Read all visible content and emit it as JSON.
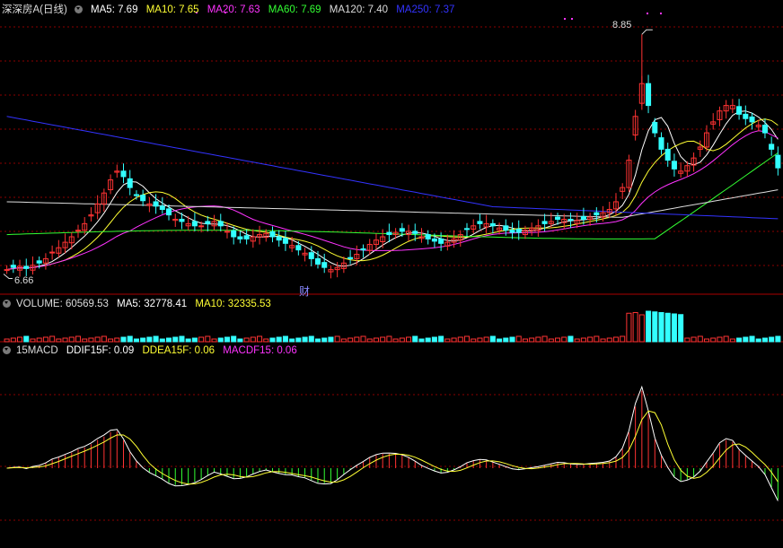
{
  "header": {
    "stock_name": "深深房A",
    "period": "(日线)",
    "ma": [
      {
        "label": "MA5",
        "value": "7.69",
        "color": "#ffffff"
      },
      {
        "label": "MA10",
        "value": "7.65",
        "color": "#ffff33"
      },
      {
        "label": "MA20",
        "value": "7.63",
        "color": "#ff33ff"
      },
      {
        "label": "MA60",
        "value": "7.69",
        "color": "#33ff33"
      },
      {
        "label": "MA120",
        "value": "7.40",
        "color": "#dddddd"
      },
      {
        "label": "MA250",
        "value": "7.37",
        "color": "#3333ff"
      }
    ]
  },
  "volume_panel": {
    "title": "VOLUME",
    "value": "60569.53",
    "ma5_label": "MA5",
    "ma5_value": "32778.41",
    "ma10_label": "MA10",
    "ma10_value": "32335.53"
  },
  "macd_panel": {
    "title": "15MACD",
    "dif_label": "DDIF15F",
    "dif_value": "0.09",
    "dea_label": "DDEA15F",
    "dea_value": "0.06",
    "macd_label": "MACDF15",
    "macd_value": "0.06"
  },
  "annotations": {
    "max_label": "8.85",
    "min_label": "6.66",
    "event_label": "财"
  },
  "colors": {
    "up": "#ff3333",
    "down": "#33ffff",
    "grid": "#8b0000",
    "ma5": "#ffffff",
    "ma10": "#ffff33",
    "ma20": "#ff33ff",
    "ma60": "#33ff33",
    "ma120": "#dddddd",
    "ma250": "#3333ff",
    "macd_pos": "#ff3333",
    "macd_neg": "#33ff33"
  },
  "chart_data": {
    "type": "candlestick",
    "price_range": [
      6.5,
      9.0
    ],
    "max_price": 8.85,
    "min_price": 6.66,
    "close_series": [
      6.7,
      6.72,
      6.73,
      6.71,
      6.74,
      6.76,
      6.8,
      6.86,
      6.9,
      6.95,
      7.0,
      7.06,
      7.12,
      7.2,
      7.3,
      7.4,
      7.52,
      7.6,
      7.55,
      7.45,
      7.38,
      7.33,
      7.3,
      7.28,
      7.25,
      7.2,
      7.16,
      7.14,
      7.12,
      7.1,
      7.1,
      7.12,
      7.14,
      7.1,
      7.05,
      7.0,
      6.98,
      6.98,
      7.0,
      7.02,
      7.03,
      7.0,
      6.97,
      6.94,
      6.92,
      6.88,
      6.85,
      6.8,
      6.75,
      6.72,
      6.7,
      6.72,
      6.76,
      6.8,
      6.84,
      6.88,
      6.93,
      6.97,
      7.0,
      7.02,
      7.04,
      7.05,
      7.05,
      7.03,
      7.0,
      6.98,
      6.96,
      6.94,
      6.95,
      6.98,
      7.02,
      7.07,
      7.1,
      7.12,
      7.12,
      7.1,
      7.08,
      7.06,
      7.04,
      7.04,
      7.06,
      7.08,
      7.1,
      7.12,
      7.14,
      7.16,
      7.16,
      7.15,
      7.15,
      7.16,
      7.18,
      7.2,
      7.22,
      7.25,
      7.32,
      7.45,
      7.7,
      8.1,
      8.4,
      8.2,
      7.95,
      7.8,
      7.7,
      7.62,
      7.6,
      7.65,
      7.72,
      7.82,
      7.95,
      8.05,
      8.15,
      8.2,
      8.2,
      8.12,
      8.08,
      8.05,
      8.02,
      7.95,
      7.8,
      7.63
    ]
  }
}
